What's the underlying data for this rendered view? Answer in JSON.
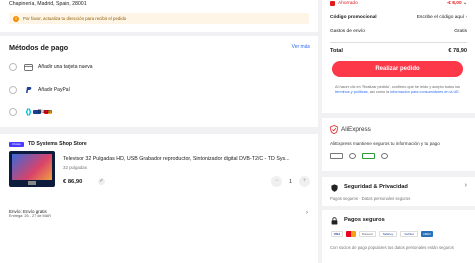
{
  "address": {
    "line": "Chapinería, Madrid, Spain, 28001",
    "warning": "Por favor, actualiza tu dirección para recibir el pedido"
  },
  "payment": {
    "title": "Métodos de pago",
    "ver_mas": "Ver más",
    "methods": [
      {
        "label": "Añadir una tarjeta nueva",
        "icon": "card-icon"
      },
      {
        "label": "Añadir PayPal",
        "icon": "paypal-icon"
      },
      {
        "label": "Bizum",
        "icon": "bizum-icon"
      }
    ]
  },
  "store": {
    "badge": "Choice",
    "name": "TD Systems Shop Store",
    "product_title": "Televisor 32 Pulgadas HD, USB Grabador reproductor, Sintonizador digital DVB-T2/C - TD Sys...",
    "variant": "32 pulgadas",
    "price": "€ 86,90",
    "quantity": "1",
    "shipping": "Envío: Envío gratis",
    "delivery": "Entrega: 26 - 27 de MAR"
  },
  "summary": {
    "ahorrado_label": "Ahorrado",
    "ahorrado_value": "-€ 8,00",
    "promo_label": "Código promocional",
    "promo_value": "Escribe el código aquí",
    "envio_label": "Gastos de envío",
    "envio_value": "Gratis",
    "total_label": "Total",
    "total_value": "€ 78,90",
    "cta": "Realizar pedido",
    "legal_1": "Al hacer clic en 'Realizar pedido', confirmo que he leído y acepto todos los ",
    "legal_link_1": "términos y políticas",
    "legal_2": ", así como la ",
    "legal_link_2": "información para consumidores en la UE",
    "legal_3": "."
  },
  "aliexpress": {
    "brand": "AliExpress",
    "text": "AliExpress mantiene seguros tu información y tu pago"
  },
  "security": {
    "title": "Seguridad & Privacidad",
    "subtitle": "Pagos seguros · Datos personales seguros"
  },
  "pagos": {
    "title": "Pagos seguros",
    "logos": [
      "VISA",
      "",
      "Discover",
      "SafeKey",
      "Verified",
      "AMEX"
    ],
    "text": "Con socios de pago populares tus datos personales están seguros"
  },
  "colors": {
    "accent": "#fd3848",
    "discount": "#e21a1a",
    "link": "#2a6cf0"
  }
}
